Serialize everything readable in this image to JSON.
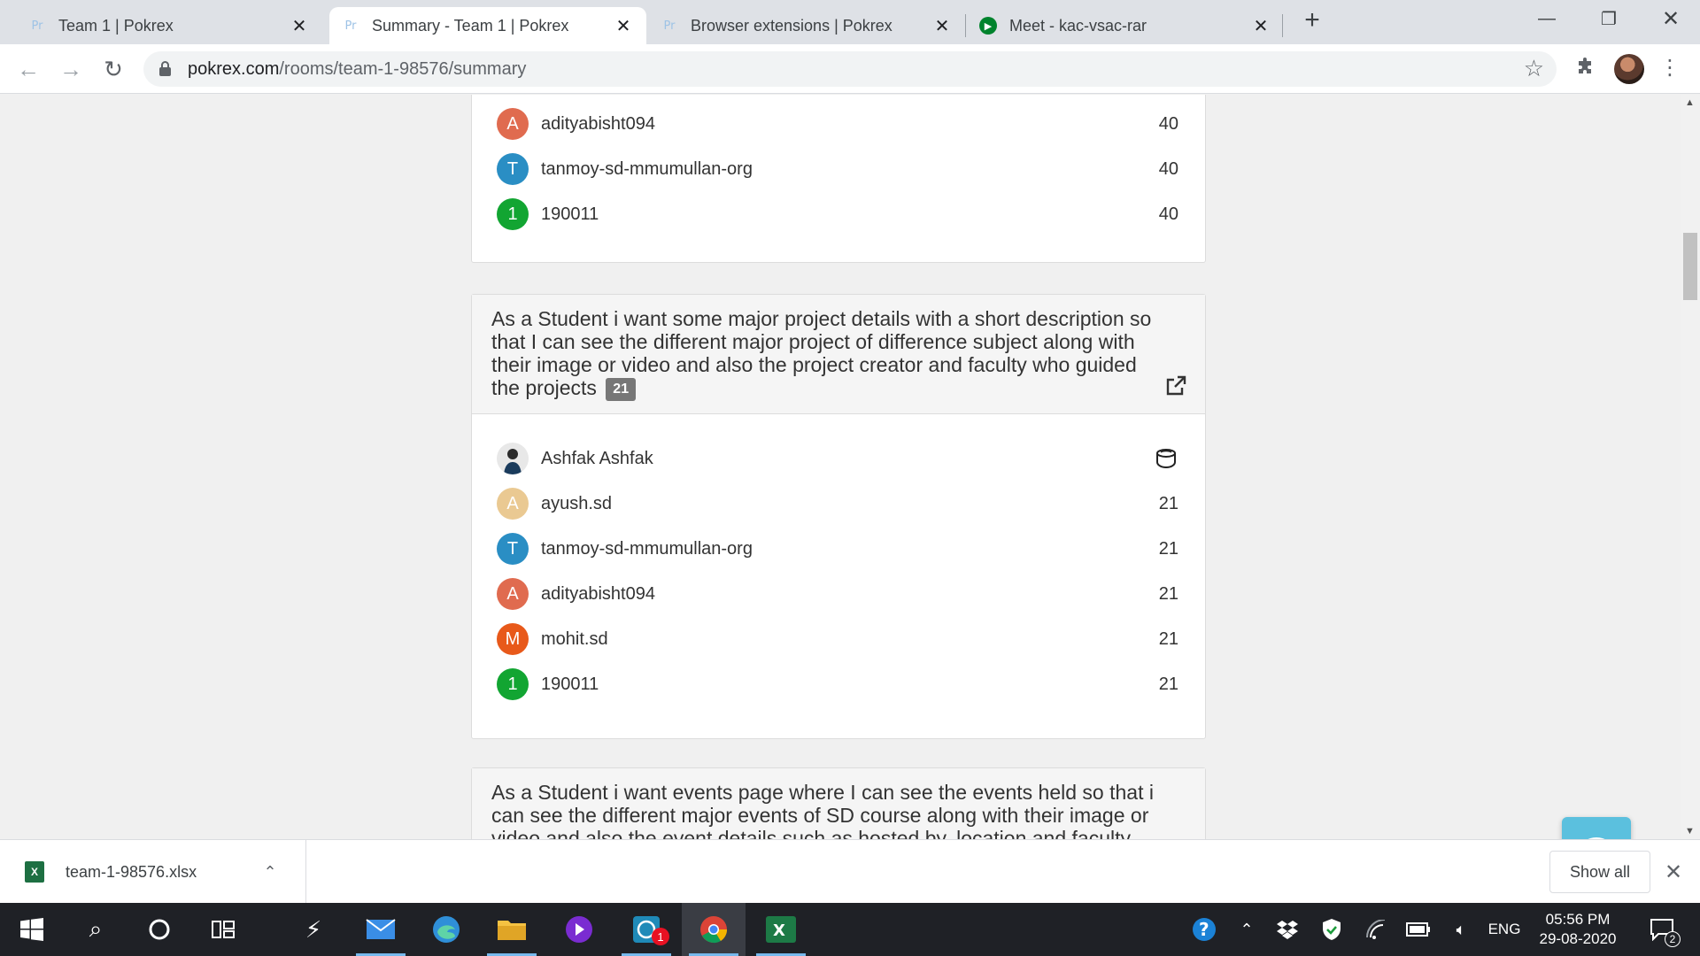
{
  "browser": {
    "tabs": [
      {
        "label": "Team 1 | Pokrex",
        "favicon": "Pr",
        "active": false
      },
      {
        "label": "Summary - Team 1 | Pokrex",
        "favicon": "Pr",
        "active": true
      },
      {
        "label": "Browser extensions | Pokrex",
        "favicon": "Pr",
        "active": false
      },
      {
        "label": "Meet - kac-vsac-rar",
        "favicon": "meet-icon",
        "active": false
      }
    ],
    "url_host": "pokrex.com",
    "url_path": "/rooms/team-1-98576/summary"
  },
  "stories": [
    {
      "text": "",
      "votes": [
        {
          "initial": "A",
          "name": "adityabisht094",
          "score": "40",
          "color": "#e06b4f"
        },
        {
          "initial": "T",
          "name": "tanmoy-sd-mmumullan-org",
          "score": "40",
          "color": "#2a8ec4"
        },
        {
          "initial": "1",
          "name": "190011",
          "score": "40",
          "color": "#12a532"
        }
      ]
    },
    {
      "text": "As a Student i want some major project details with a short description so that I can see the different major project of difference subject along with their image or video and also the project creator and faculty who guided the projects",
      "points": "21",
      "votes": [
        {
          "initial": "",
          "name": "Ashfak Ashfak",
          "score": "coffee-icon",
          "photo": true
        },
        {
          "initial": "A",
          "name": "ayush.sd",
          "score": "21",
          "color": "#eac992"
        },
        {
          "initial": "T",
          "name": "tanmoy-sd-mmumullan-org",
          "score": "21",
          "color": "#2a8ec4"
        },
        {
          "initial": "A",
          "name": "adityabisht094",
          "score": "21",
          "color": "#e06b4f"
        },
        {
          "initial": "M",
          "name": "mohit.sd",
          "score": "21",
          "color": "#e8591a"
        },
        {
          "initial": "1",
          "name": "190011",
          "score": "21",
          "color": "#12a532"
        }
      ]
    },
    {
      "text": "As a Student i want events page where I can see the events held so that i can see the different major events of SD course along with their image or video and also the event details such as hosted by, location and faculty"
    }
  ],
  "download": {
    "filename": "team-1-98576.xlsx",
    "icon": "excel-icon",
    "show_all": "Show all"
  },
  "taskbar": {
    "time": "05:56 PM",
    "date": "29-08-2020",
    "lang": "ENG",
    "badge_count": "1",
    "notif_count": "2"
  }
}
